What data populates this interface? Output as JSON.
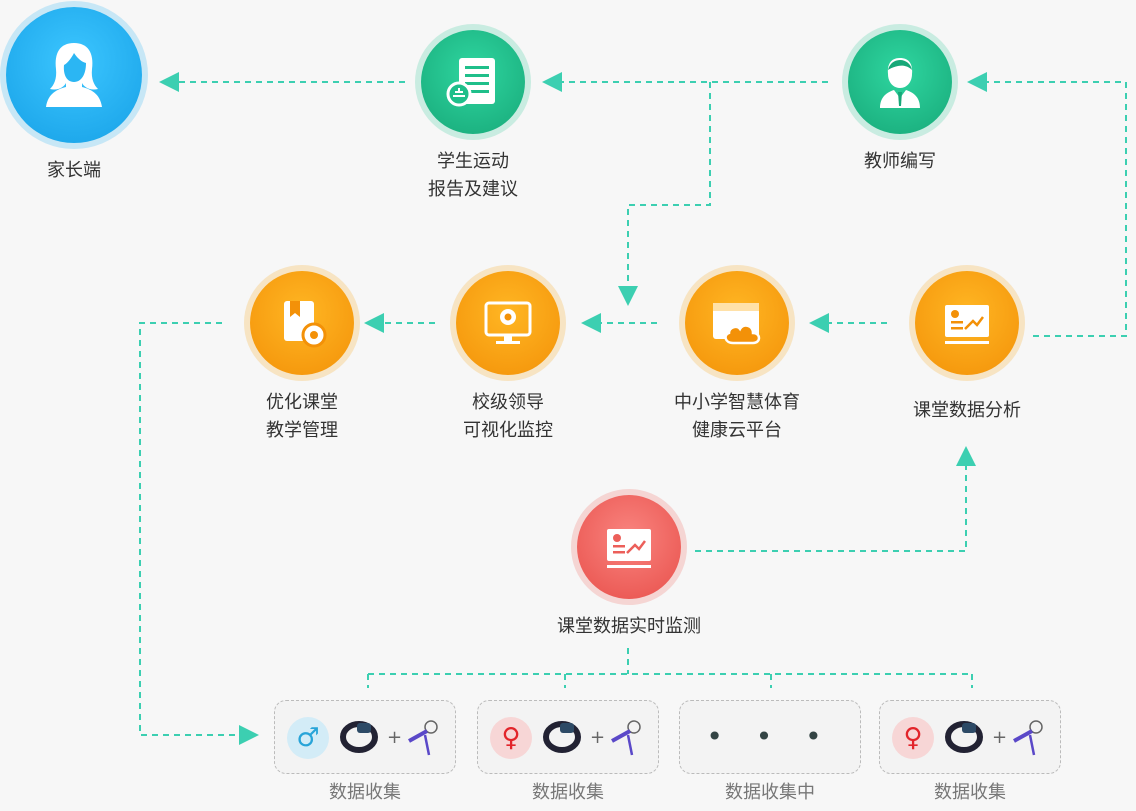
{
  "nodes": {
    "parent": {
      "label": "家长端"
    },
    "report": {
      "line1": "学生运动",
      "line2": "报告及建议"
    },
    "teacher": {
      "label": "教师编写"
    },
    "optimize": {
      "line1": "优化课堂",
      "line2": "教学管理"
    },
    "leader": {
      "line1": "校级领导",
      "line2": "可视化监控"
    },
    "platform": {
      "line1": "中小学智慧体育",
      "line2": "健康云平台"
    },
    "analysis": {
      "label": "课堂数据分析"
    },
    "realtime": {
      "label": "课堂数据实时监测"
    }
  },
  "collection": {
    "boxes": [
      {
        "label": "数据收集",
        "gender": "♂",
        "plus": "+"
      },
      {
        "label": "数据收集",
        "gender": "♀",
        "plus": "+"
      },
      {
        "label": "数据收集中",
        "ellipsis": "• • •"
      },
      {
        "label": "数据收集",
        "gender": "♀",
        "plus": "+"
      }
    ]
  },
  "colors": {
    "connector": "#3ccfb1",
    "blue": "#1fb0ee",
    "green": "#1fbf8a",
    "orange": "#f7a114",
    "red": "#ec5f5a"
  }
}
